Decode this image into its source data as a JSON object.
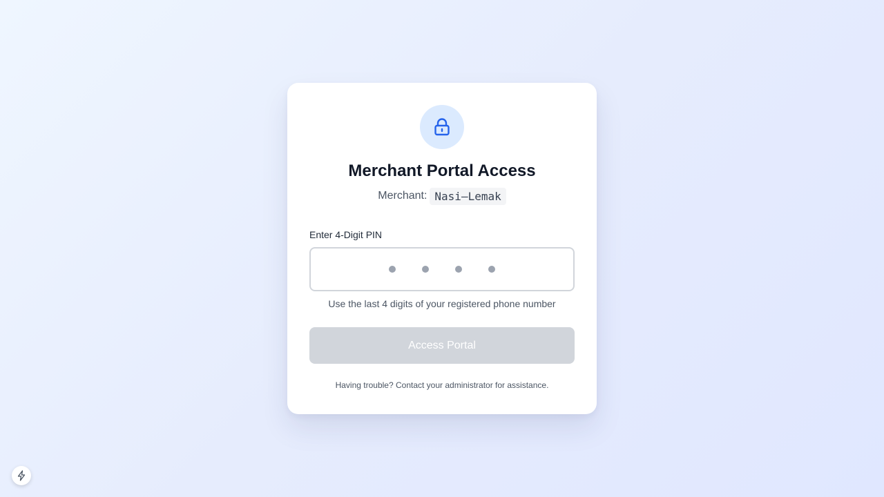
{
  "card": {
    "icon": "lock-icon",
    "title": "Merchant Portal Access",
    "merchant_label": "Merchant:",
    "merchant_name": "Nasi–Lemak"
  },
  "pin": {
    "label": "Enter 4-Digit PIN",
    "digits_entered": 0,
    "digit_count": 4,
    "hint": "Use the last 4 digits of your registered phone number"
  },
  "actions": {
    "submit_label": "Access Portal",
    "submit_enabled": false
  },
  "help_text": "Having trouble? Contact your administrator for assistance.",
  "floating_button": {
    "icon": "lightning-icon"
  },
  "colors": {
    "accent": "#2563eb",
    "icon_bg": "#dbeafe",
    "button_disabled": "#d1d5db",
    "title": "#111827"
  }
}
